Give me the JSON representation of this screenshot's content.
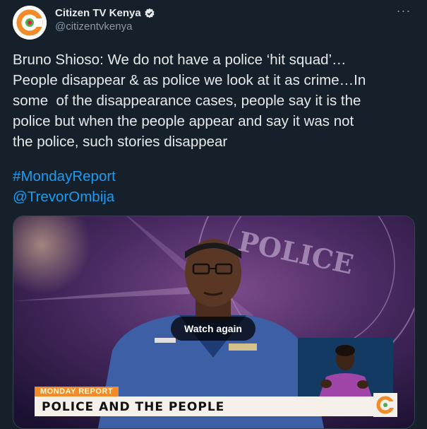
{
  "tweet": {
    "display_name": "Citizen TV Kenya",
    "handle": "@citizentvkenya",
    "more_label": "···",
    "body": "Bruno Shioso: We do not have a police ‘hit squad’…\nPeople disappear & as police we look at it as crime…In\nsome  of the disappearance cases, people say it is the\npolice but when the people appear and say it was not\nthe police, such stories disappear",
    "hashtag": "#MondayReport",
    "mention": "@TrevorOmbija"
  },
  "media": {
    "watch_again_label": "Watch again",
    "banner_label": "MONDAY REPORT",
    "banner_title": "POLICE AND THE PEOPLE",
    "backdrop_text": "POLICE"
  },
  "colors": {
    "background": "#15202b",
    "link": "#1d9bf0",
    "verified": "#e7e9ea",
    "brand_orange": "#f28c28"
  },
  "icons": {
    "avatar": "citizen-tv-logo",
    "verified": "verified-badge-icon",
    "more": "more-options-icon"
  }
}
